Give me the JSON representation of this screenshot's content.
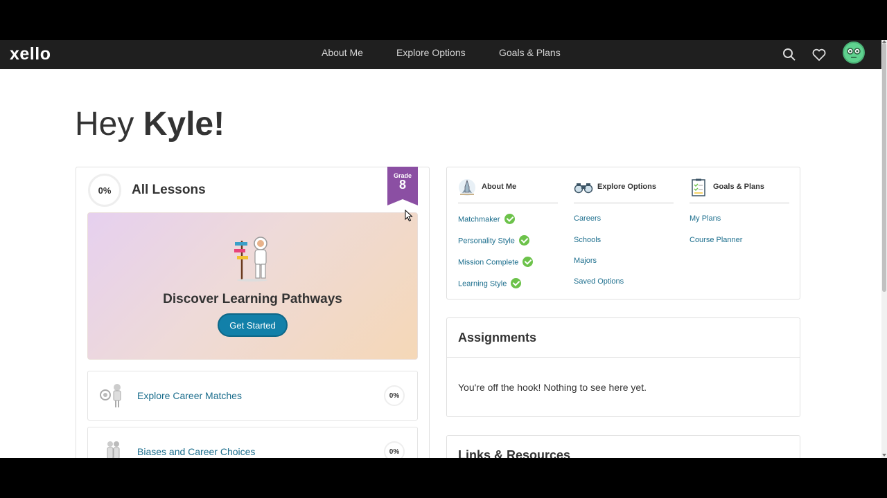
{
  "brand": {
    "logo": "xello"
  },
  "nav": {
    "links": [
      "About Me",
      "Explore Options",
      "Goals & Plans"
    ],
    "icons": [
      "search-icon",
      "heart-icon",
      "avatar"
    ]
  },
  "greeting": {
    "prefix": "Hey",
    "name": "Kyle!"
  },
  "lessons": {
    "progress": "0%",
    "title": "All Lessons",
    "grade_label": "Grade",
    "grade_value": "8",
    "hero": {
      "title": "Discover Learning Pathways",
      "button": "Get Started"
    },
    "items": [
      {
        "label": "Explore Career Matches",
        "progress": "0%"
      },
      {
        "label": "Biases and Career Choices",
        "progress": "0%"
      }
    ]
  },
  "sections": [
    {
      "title": "About Me",
      "icon": "rocket-icon",
      "links": [
        {
          "label": "Matchmaker",
          "complete": true
        },
        {
          "label": "Personality Style",
          "complete": true
        },
        {
          "label": "Mission Complete",
          "complete": true
        },
        {
          "label": "Learning Style",
          "complete": true
        }
      ]
    },
    {
      "title": "Explore Options",
      "icon": "binoculars-icon",
      "links": [
        {
          "label": "Careers",
          "complete": false
        },
        {
          "label": "Schools",
          "complete": false
        },
        {
          "label": "Majors",
          "complete": false
        },
        {
          "label": "Saved Options",
          "complete": false
        }
      ]
    },
    {
      "title": "Goals & Plans",
      "icon": "checklist-icon",
      "links": [
        {
          "label": "My Plans",
          "complete": false
        },
        {
          "label": "Course Planner",
          "complete": false
        }
      ]
    }
  ],
  "assignments": {
    "title": "Assignments",
    "empty": "You're off the hook! Nothing to see here yet."
  },
  "links_resources": {
    "title": "Links & Resources"
  },
  "colors": {
    "accent": "#1280a9",
    "grade_ribbon": "#8b4fa3",
    "check": "#6cc24a",
    "topbar": "#1f1f1f"
  }
}
